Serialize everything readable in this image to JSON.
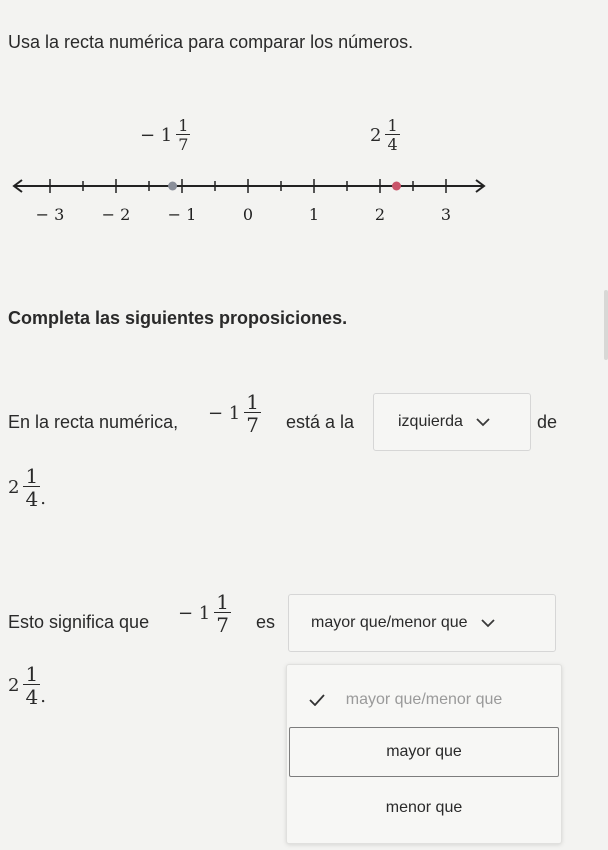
{
  "prompt": {
    "title": "Usa la recta numérica para comparar los números.",
    "subtitle": "Completa las siguientes proposiciones."
  },
  "number_line": {
    "ticks": [
      "− 3",
      "− 2",
      "− 1",
      "0",
      "1",
      "2",
      "3"
    ],
    "points": [
      {
        "whole": "− 1",
        "num": "1",
        "den": "7",
        "value": -1.142857,
        "color": "#8a8f9a"
      },
      {
        "whole": "2",
        "num": "1",
        "den": "4",
        "value": 2.25,
        "color": "#c9546a"
      }
    ]
  },
  "statement1": {
    "prefix": "En la recta numérica,",
    "frac_whole": "− 1",
    "frac_num": "1",
    "frac_den": "7",
    "middle": "está a la",
    "dropdown_value": "izquierda",
    "suffix": "de",
    "end_whole": "2",
    "end_num": "1",
    "end_den": "4",
    "end_punct": "."
  },
  "statement2": {
    "prefix": "Esto signiﬁca que",
    "frac_whole": "− 1",
    "frac_num": "1",
    "frac_den": "7",
    "middle": "es",
    "dropdown_value": "mayor que/menor que",
    "end_whole": "2",
    "end_num": "1",
    "end_den": "4",
    "end_punct": "."
  },
  "menu": {
    "options": [
      "mayor que/menor que",
      "mayor que",
      "menor que"
    ]
  }
}
